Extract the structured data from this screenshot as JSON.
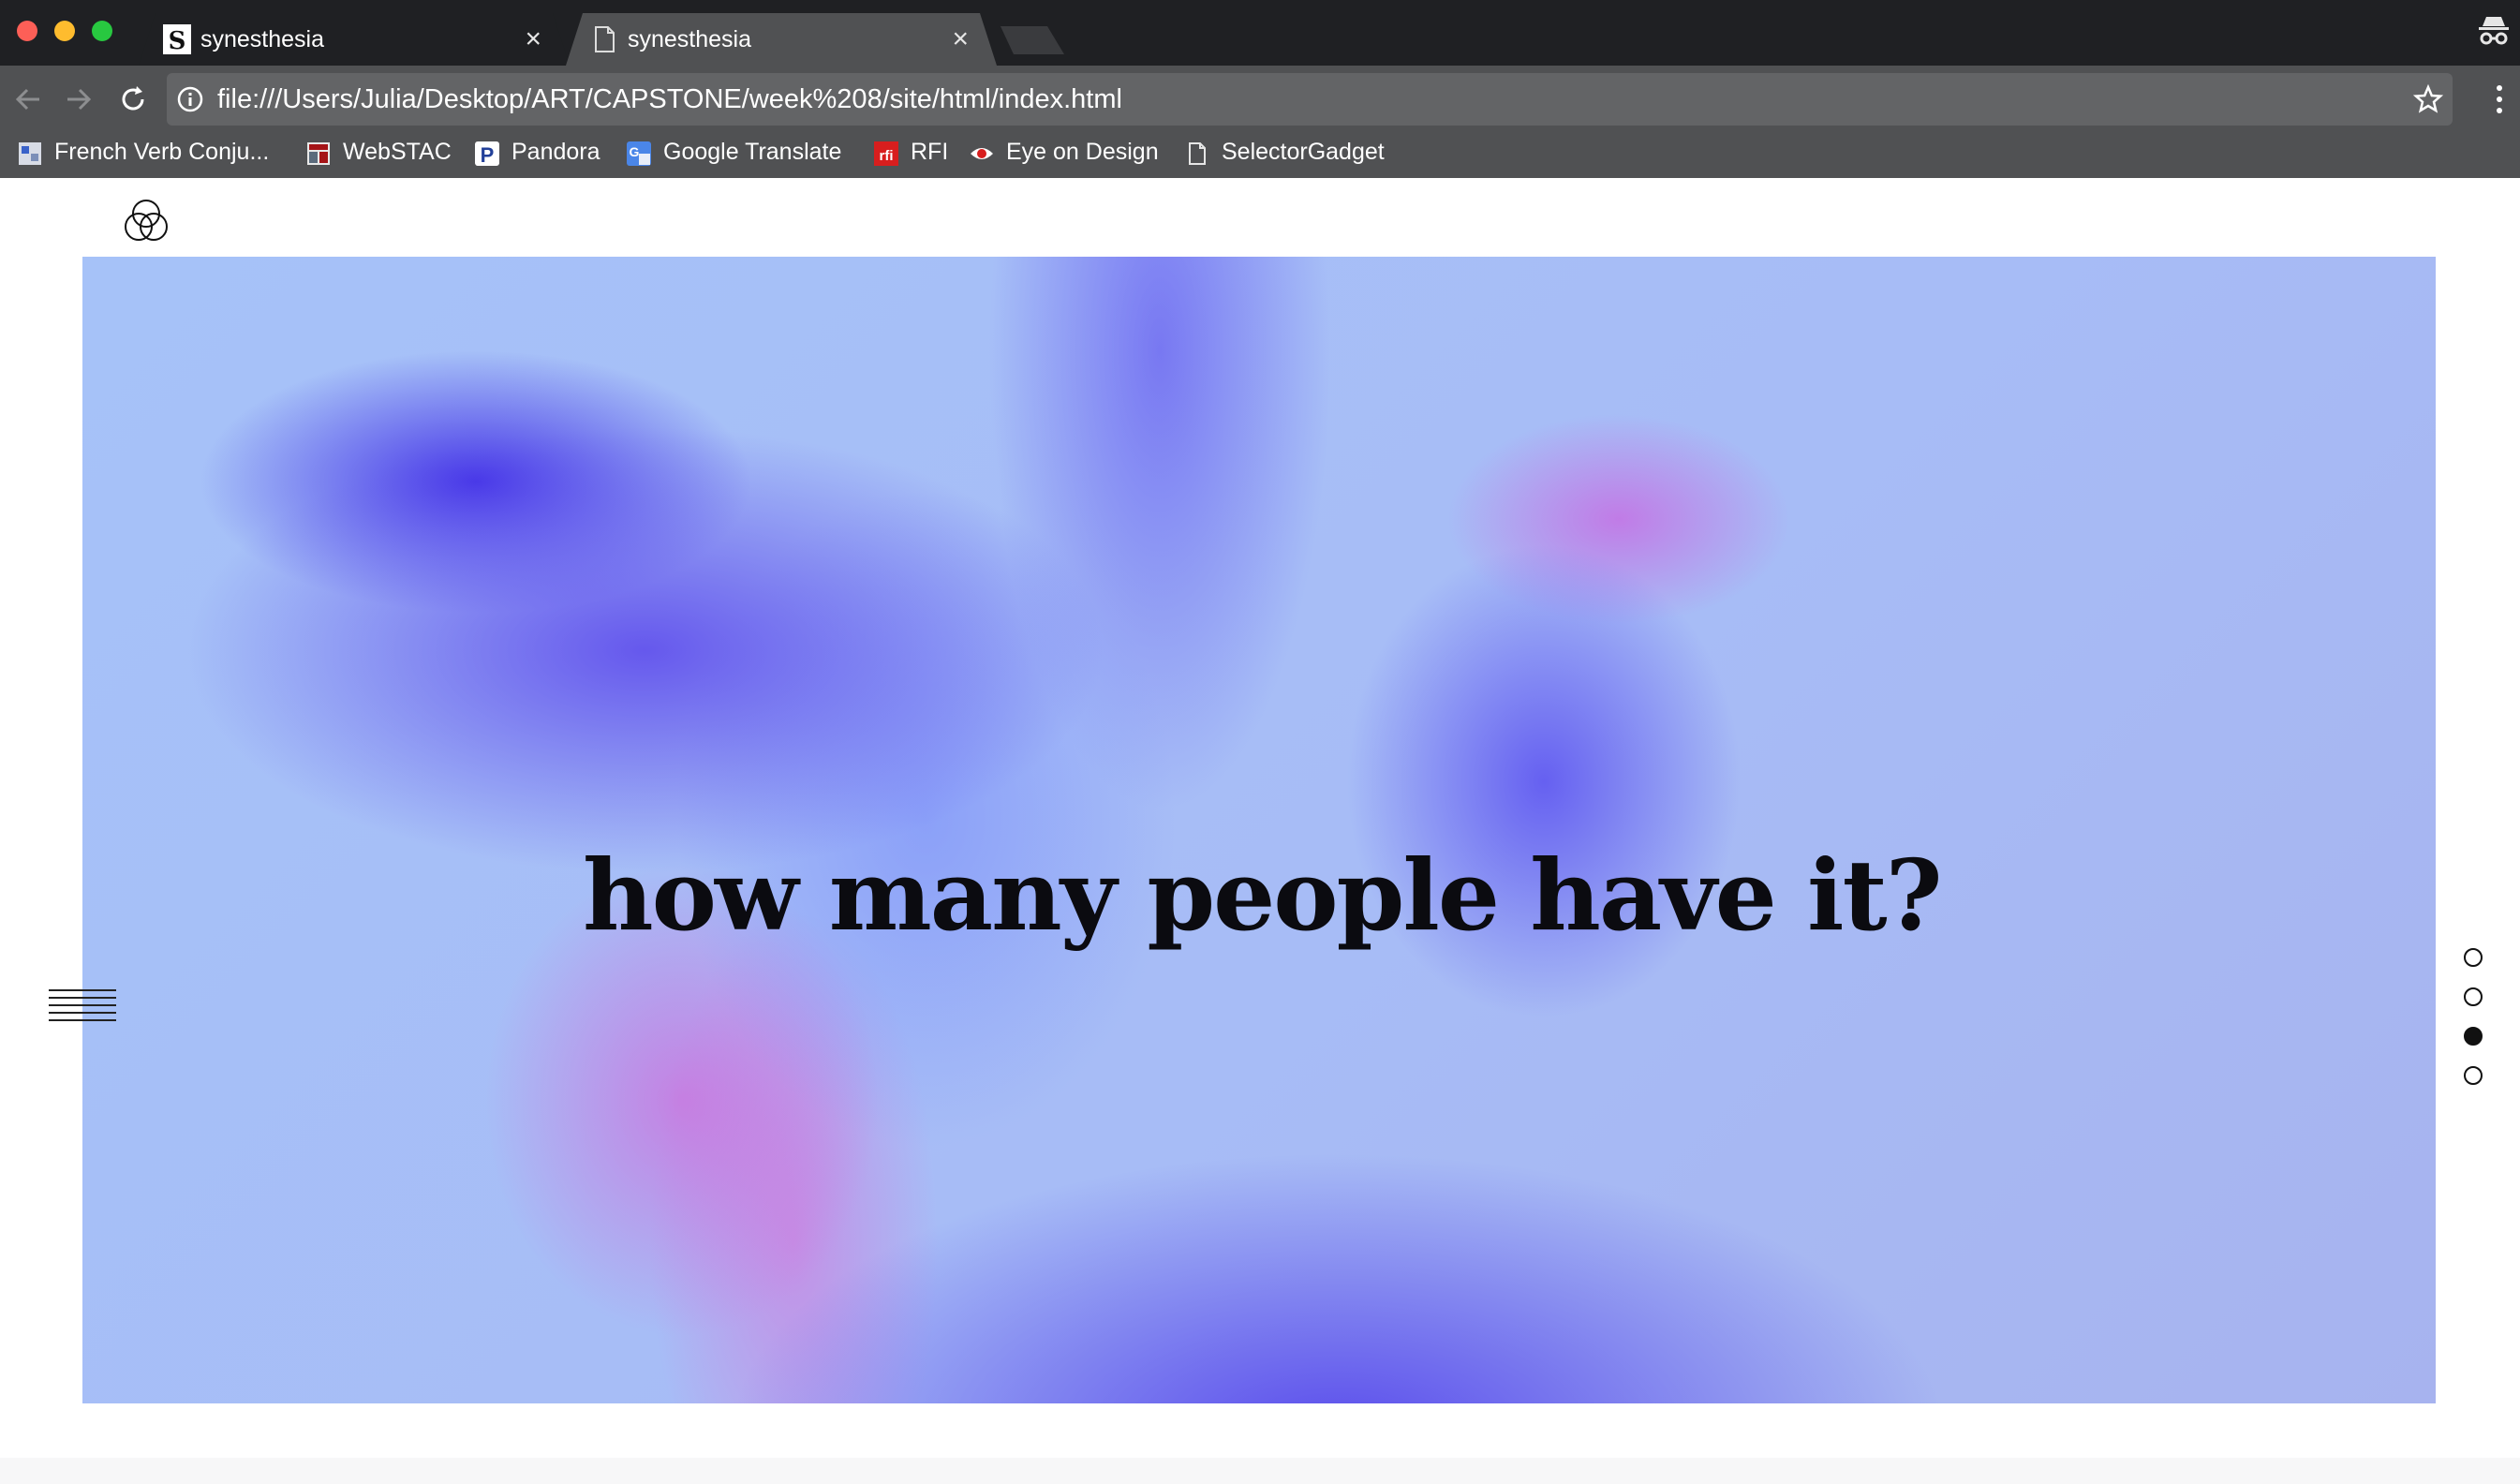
{
  "browser": {
    "tabs": [
      {
        "title": "synesthesia",
        "favicon": "s-logo-icon",
        "close": "×"
      },
      {
        "title": "synesthesia",
        "favicon": "page-icon",
        "close": "×"
      }
    ],
    "url": "file:///Users/Julia/Desktop/ART/CAPSTONE/week%208/site/html/index.html",
    "bookmarks": [
      {
        "label": "French Verb Conju...",
        "icon": "conjugation-icon"
      },
      {
        "label": "WebSTAC",
        "icon": "webstac-icon"
      },
      {
        "label": "Pandora",
        "icon": "pandora-icon"
      },
      {
        "label": "Google Translate",
        "icon": "google-translate-icon"
      },
      {
        "label": "RFI",
        "icon": "rfi-icon"
      },
      {
        "label": "Eye on Design",
        "icon": "eye-icon"
      },
      {
        "label": "SelectorGadget",
        "icon": "page-icon"
      }
    ]
  },
  "page": {
    "headline": "how many people have it?",
    "pagination": {
      "total": 4,
      "active_index": 2
    }
  },
  "colors": {
    "titlebar": "#1f2023",
    "toolbar": "#505153",
    "hero_base": "#a6c2f8",
    "hero_accent_blue": "#5a46eb",
    "hero_accent_pink": "#dc50d2"
  }
}
